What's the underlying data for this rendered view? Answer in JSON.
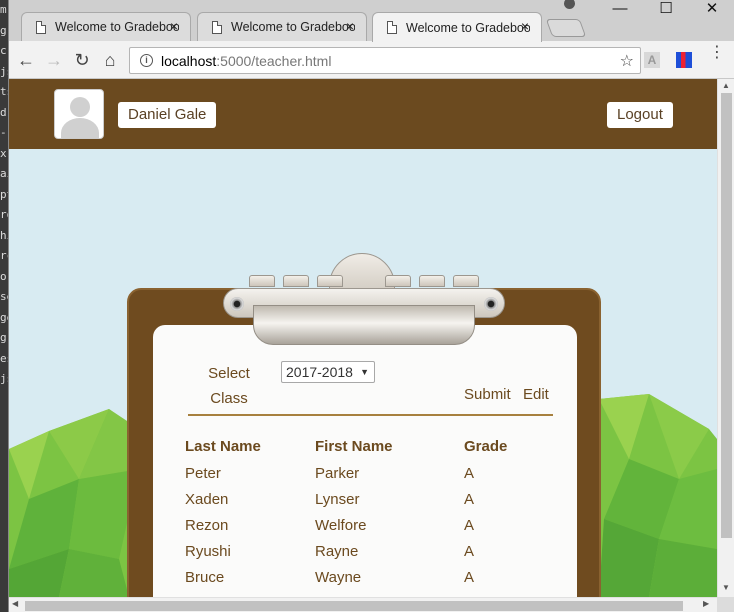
{
  "background_window": {
    "lines": [
      "m",
      "g",
      "c",
      "js",
      "ts",
      "d",
      "-",
      "x",
      "ai",
      "pt",
      "ro",
      "hi",
      "rc",
      "o",
      "se",
      "ge",
      "g",
      "es",
      "js"
    ]
  },
  "browser": {
    "tabs": [
      {
        "title": "Welcome to Gradebook",
        "close": "×"
      },
      {
        "title": "Welcome to Gradebook",
        "close": "×"
      },
      {
        "title": "Welcome to Gradebook",
        "close": "×"
      }
    ],
    "window_controls": {
      "minimize": "—",
      "maximize": "☐",
      "close": "✕"
    },
    "nav": {
      "back": "←",
      "forward": "→",
      "reload": "↻",
      "home": "⌂"
    },
    "address": {
      "host": "localhost",
      "path": ":5000/teacher.html"
    },
    "bookmark_star": "☆",
    "menu": "⋮",
    "pdf_ext_label": "A"
  },
  "header": {
    "user_name": "Daniel Gale",
    "logout_label": "Logout"
  },
  "controls": {
    "select_label": "Select Class",
    "year_value": "2017-2018",
    "year_arrow": "▼",
    "submit_label": "Submit",
    "edit_label": "Edit"
  },
  "table": {
    "headers": [
      "Last Name",
      "First Name",
      "Grade"
    ],
    "rows": [
      [
        "Peter",
        "Parker",
        "A"
      ],
      [
        "Xaden",
        "Lynser",
        "A"
      ],
      [
        "Rezon",
        "Welfore",
        "A"
      ],
      [
        "Ryushi",
        "Rayne",
        "A"
      ],
      [
        "Bruce",
        "Wayne",
        "A"
      ]
    ]
  },
  "colors": {
    "header_brown": "#6b4a1f",
    "sky": "#d8ebf2",
    "hill_green": "#6fbf3f",
    "paper": "#fbfbfa"
  },
  "scroll": {
    "up": "▲",
    "down": "▼",
    "left": "◀",
    "right": "▶"
  }
}
